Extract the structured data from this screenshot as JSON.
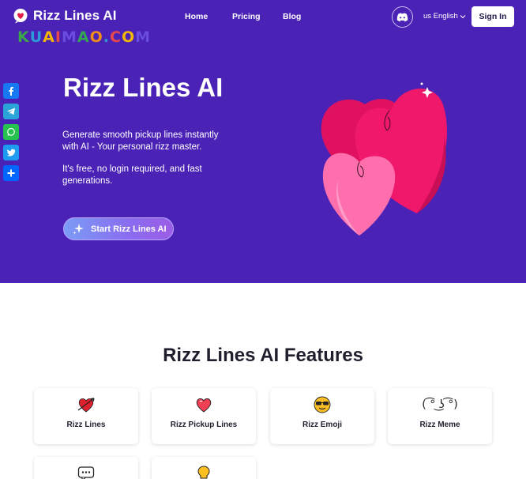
{
  "header": {
    "logo_text": "Rizz Lines AI",
    "watermark": "KUAIMAO.COM",
    "nav": [
      "Home",
      "Pricing",
      "Blog"
    ],
    "language": "us English",
    "sign_in": "Sign In"
  },
  "share_icons": [
    "facebook-icon",
    "telegram-icon",
    "whatsapp-icon",
    "twitter-icon",
    "share-plus-icon"
  ],
  "hero": {
    "title": "Rizz Lines AI",
    "description": "Generate smooth pickup lines instantly with AI - Your personal rizz master.",
    "description2": "It's free, no login required, and fast generations.",
    "cta": "Start Rizz Lines AI",
    "background": "#4a22b5"
  },
  "features": {
    "title": "Rizz Lines AI Features",
    "cards": [
      {
        "label": "Rizz Lines",
        "icon": "heart-arrow-icon"
      },
      {
        "label": "Rizz Pickup Lines",
        "icon": "heart-icon"
      },
      {
        "label": "Rizz Emoji",
        "icon": "sunglasses-emoji-icon"
      },
      {
        "label": "Rizz Meme",
        "icon": "lenny-face-icon",
        "glyph": "( ͡° ͜ʖ ͡°)"
      },
      {
        "label": "",
        "icon": "chat-bubble-icon"
      },
      {
        "label": "",
        "icon": "lightbulb-icon"
      }
    ]
  }
}
